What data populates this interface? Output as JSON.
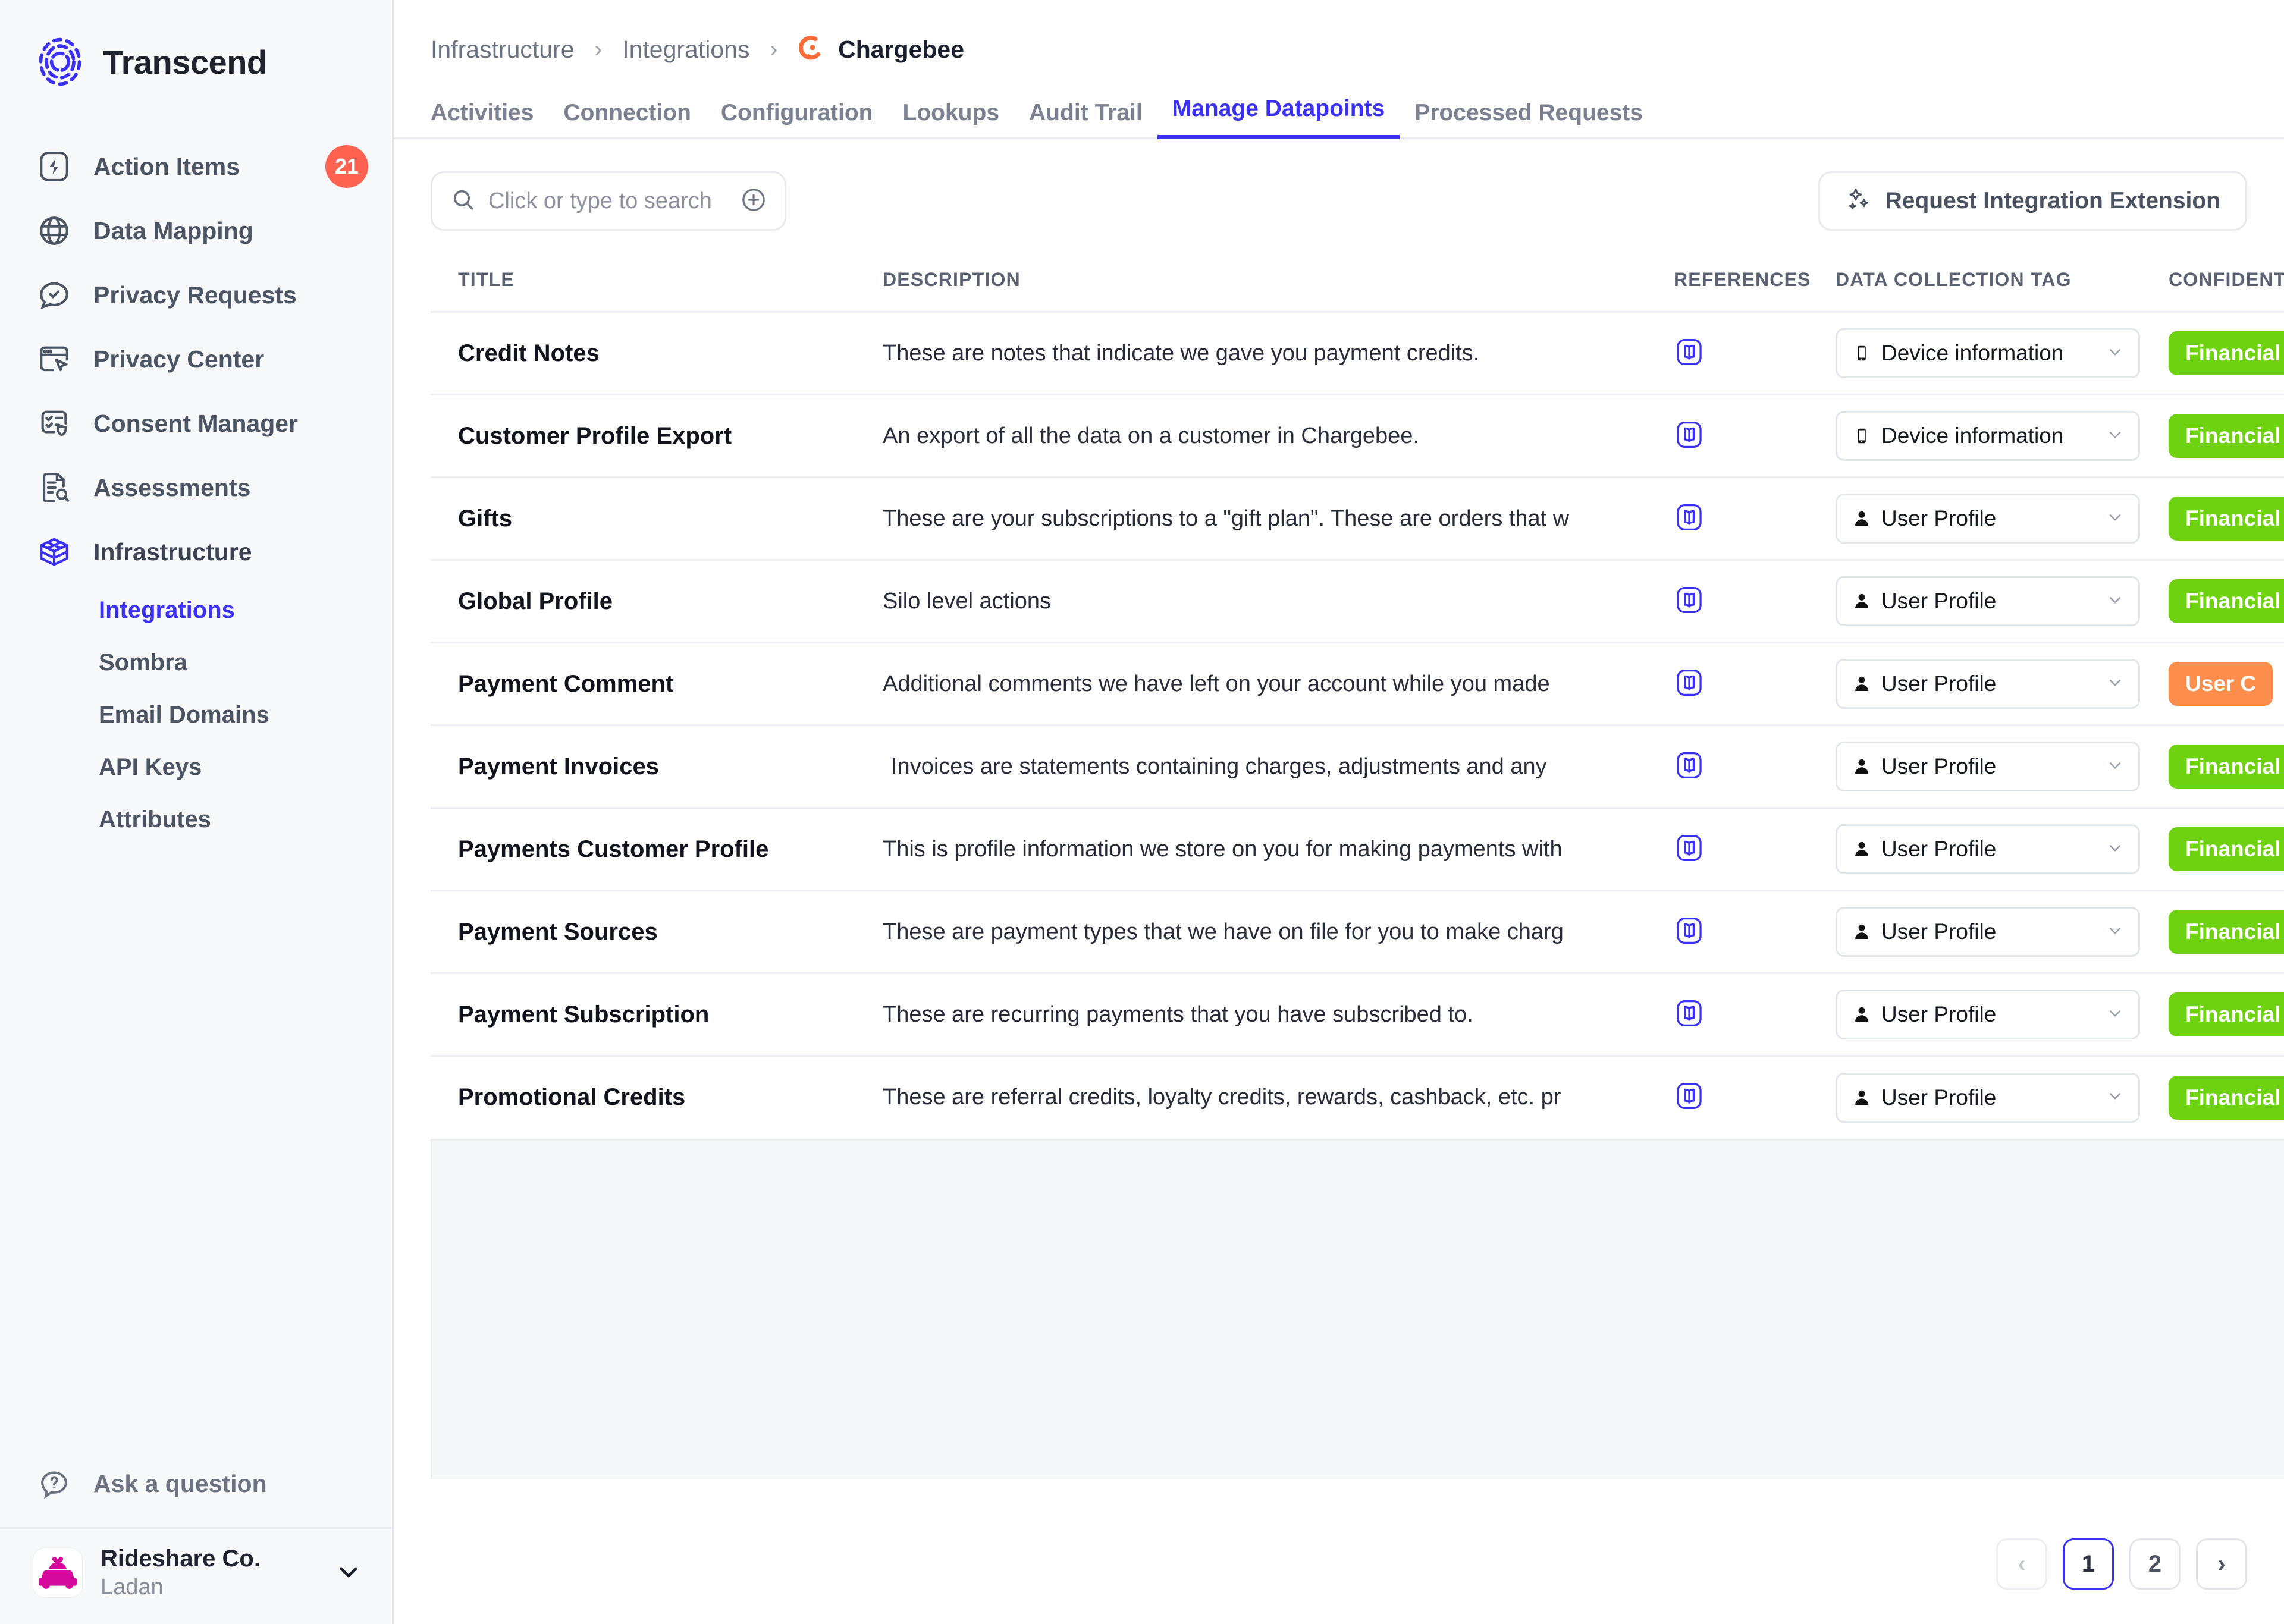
{
  "brand": {
    "name": "Transcend",
    "logo_icon": "transcend-logo-icon"
  },
  "sidebar": {
    "items": [
      {
        "label": "Action Items",
        "icon": "bolt-icon",
        "badge": "21"
      },
      {
        "label": "Data Mapping",
        "icon": "globe-icon"
      },
      {
        "label": "Privacy Requests",
        "icon": "chat-check-icon"
      },
      {
        "label": "Privacy Center",
        "icon": "browser-cursor-icon"
      },
      {
        "label": "Consent Manager",
        "icon": "checklist-shield-icon"
      },
      {
        "label": "Assessments",
        "icon": "document-search-icon"
      },
      {
        "label": "Infrastructure",
        "icon": "box-icon"
      }
    ],
    "subitems": [
      {
        "label": "Integrations",
        "selected": true
      },
      {
        "label": "Sombra",
        "selected": false
      },
      {
        "label": "Email Domains",
        "selected": false
      },
      {
        "label": "API Keys",
        "selected": false
      },
      {
        "label": "Attributes",
        "selected": false
      }
    ],
    "help": {
      "label": "Ask a question",
      "icon": "question-bubble-icon"
    },
    "profile": {
      "org": "Rideshare Co.",
      "user": "Ladan",
      "avatar_icon": "rideshare-car-icon",
      "chevron_icon": "chevron-down-icon"
    }
  },
  "breadcrumb": {
    "items": [
      "Infrastructure",
      "Integrations"
    ],
    "separator": "›",
    "current": "Chargebee",
    "current_icon": "chargebee-logo-icon"
  },
  "tabs": [
    {
      "label": "Activities",
      "active": false
    },
    {
      "label": "Connection",
      "active": false
    },
    {
      "label": "Configuration",
      "active": false
    },
    {
      "label": "Lookups",
      "active": false
    },
    {
      "label": "Audit Trail",
      "active": false
    },
    {
      "label": "Manage Datapoints",
      "active": true
    },
    {
      "label": "Processed Requests",
      "active": false
    }
  ],
  "toolbar": {
    "search_placeholder": "Click or type to search",
    "search_value": "",
    "search_icon": "search-icon",
    "add_icon": "plus-circle-icon",
    "extension_label": "Request Integration Extension",
    "extension_icon": "sparkles-icon"
  },
  "table": {
    "columns": [
      "TITLE",
      "DESCRIPTION",
      "REFERENCES",
      "DATA COLLECTION TAG",
      "CONFIDENTIALITY"
    ],
    "rows": [
      {
        "title": "Credit Notes",
        "description": "These are notes that indicate we gave you payment credits.",
        "reference_icon": "book-reference-icon",
        "tag": "Device information",
        "tag_icon": "phone-icon",
        "confidentiality": "Financial",
        "confidentiality_color": "green"
      },
      {
        "title": "Customer Profile Export",
        "description": "An export of all the data on a customer in Chargebee.",
        "reference_icon": "book-reference-icon",
        "tag": "Device information",
        "tag_icon": "phone-icon",
        "confidentiality": "Financial",
        "confidentiality_color": "green"
      },
      {
        "title": "Gifts",
        "description": "These are your subscriptions to a \"gift plan\". These are orders that w",
        "reference_icon": "book-reference-icon",
        "tag": "User Profile",
        "tag_icon": "person-icon",
        "confidentiality": "Financial",
        "confidentiality_color": "green"
      },
      {
        "title": "Global Profile",
        "description": "Silo level actions",
        "reference_icon": "book-reference-icon",
        "tag": "User Profile",
        "tag_icon": "person-icon",
        "confidentiality": "Financial",
        "confidentiality_color": "green"
      },
      {
        "title": "Payment Comment",
        "description": "Additional comments we have left on your account while you made",
        "reference_icon": "book-reference-icon",
        "tag": "User Profile",
        "tag_icon": "person-icon",
        "confidentiality": "User C",
        "confidentiality_color": "orange"
      },
      {
        "title": "Payment Invoices",
        "description": "Invoices are statements containing charges, adjustments and any",
        "reference_icon": "book-reference-icon",
        "tag": "User Profile",
        "tag_icon": "person-icon",
        "confidentiality": "Financial",
        "confidentiality_color": "green",
        "indent": true
      },
      {
        "title": "Payments Customer Profile",
        "description": "This is profile information we store on you for making payments with",
        "reference_icon": "book-reference-icon",
        "tag": "User Profile",
        "tag_icon": "person-icon",
        "confidentiality": "Financial",
        "confidentiality_color": "green"
      },
      {
        "title": "Payment Sources",
        "description": "These are payment types that we have on file for you to make charg",
        "reference_icon": "book-reference-icon",
        "tag": "User Profile",
        "tag_icon": "person-icon",
        "confidentiality": "Financial",
        "confidentiality_color": "green"
      },
      {
        "title": "Payment Subscription",
        "description": "These are recurring payments that you have subscribed to.",
        "reference_icon": "book-reference-icon",
        "tag": "User Profile",
        "tag_icon": "person-icon",
        "confidentiality": "Financial",
        "confidentiality_color": "green"
      },
      {
        "title": "Promotional Credits",
        "description": "These are referral credits, loyalty credits, rewards, cashback, etc. pr",
        "reference_icon": "book-reference-icon",
        "tag": "User Profile",
        "tag_icon": "person-icon",
        "confidentiality": "Financial",
        "confidentiality_color": "green"
      }
    ]
  },
  "pagination": {
    "prev": "‹",
    "next": "›",
    "pages": [
      "1",
      "2"
    ],
    "current": "1"
  },
  "colors": {
    "accent": "#3b30f5",
    "badge_red": "#ff6250",
    "green": "#6fd211",
    "orange": "#fd8d4a",
    "chargebee_orange": "#ff6b36",
    "avatar_pink": "#d4089a"
  }
}
